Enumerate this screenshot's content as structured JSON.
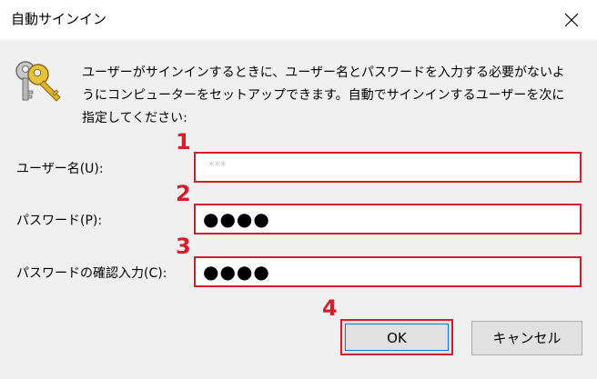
{
  "window": {
    "title": "自動サインイン"
  },
  "description": "ユーザーがサインインするときに、ユーザー名とパスワードを入力する必要がないようにコンピューターをセットアップできます。自動でサインインするユーザーを次に指定してください:",
  "fields": {
    "username": {
      "label": "ユーザー名(U):",
      "value": "***"
    },
    "password": {
      "label": "パスワード(P):",
      "value": "●●●●"
    },
    "confirm": {
      "label": "パスワードの確認入力(C):",
      "value": "●●●●"
    }
  },
  "steps": [
    "1",
    "2",
    "3",
    "4"
  ],
  "buttons": {
    "ok": "OK",
    "cancel": "キャンセル"
  },
  "colors": {
    "highlight": "#d0202c",
    "background": "#f0f0f0",
    "focus": "#0078d7"
  }
}
